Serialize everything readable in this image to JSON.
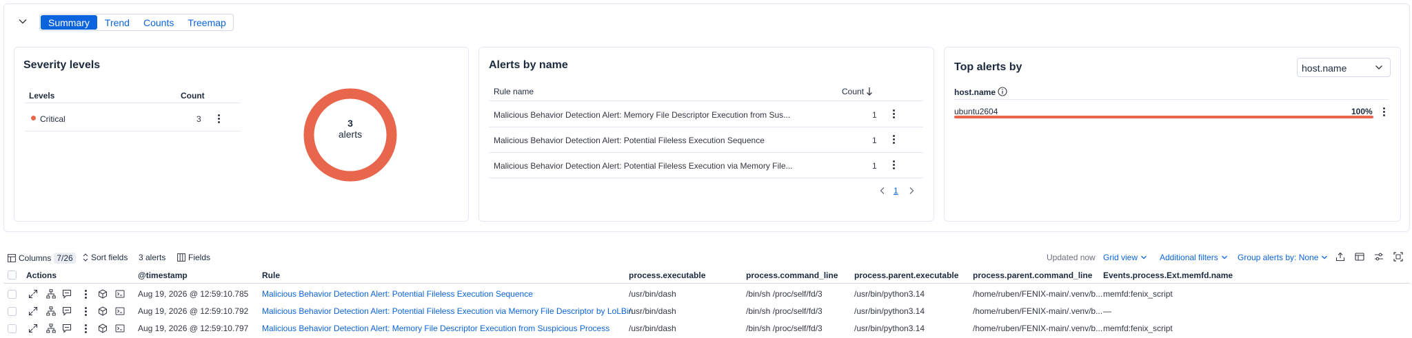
{
  "tabs": [
    {
      "label": "Summary"
    },
    {
      "label": "Trend"
    },
    {
      "label": "Counts"
    },
    {
      "label": "Treemap"
    }
  ],
  "severity": {
    "title": "Severity levels",
    "col_levels": "Levels",
    "col_count": "Count",
    "rows": [
      {
        "level": "Critical",
        "count": "3",
        "color": "#e7664c"
      }
    ],
    "donut_value": "3",
    "donut_label": "alerts",
    "donut_color": "#e7664c"
  },
  "alerts_by_name": {
    "title": "Alerts by name",
    "col_rule": "Rule name",
    "col_count": "Count",
    "rows": [
      {
        "name": "Malicious Behavior Detection Alert: Memory File Descriptor Execution from Sus...",
        "count": "1"
      },
      {
        "name": "Malicious Behavior Detection Alert: Potential Fileless Execution Sequence",
        "count": "1"
      },
      {
        "name": "Malicious Behavior Detection Alert: Potential Fileless Execution via Memory File...",
        "count": "1"
      }
    ],
    "page": "1"
  },
  "top_alerts": {
    "title": "Top alerts by",
    "select_value": "host.name",
    "field_label": "host.name",
    "rows": [
      {
        "name": "ubuntu2604",
        "percent": "100%",
        "fraction": 1.0,
        "color": "#e7664c"
      }
    ]
  },
  "toolbar": {
    "columns_label": "Columns",
    "columns_count": "7/26",
    "sort_label": "Sort fields",
    "alerts_count": "3 alerts",
    "fields_label": "Fields",
    "updated": "Updated now",
    "grid_view": "Grid view",
    "additional_filters": "Additional filters",
    "group_by": "Group alerts by: None"
  },
  "table": {
    "headers": {
      "actions": "Actions",
      "timestamp": "@timestamp",
      "rule": "Rule",
      "executable": "process.executable",
      "command_line": "process.command_line",
      "parent_executable": "process.parent.executable",
      "parent_command_line": "process.parent.command_line",
      "memfd": "Events.process.Ext.memfd.name"
    },
    "rows": [
      {
        "timestamp": "Aug 19, 2026 @ 12:59:10.785",
        "rule": "Malicious Behavior Detection Alert: Potential Fileless Execution Sequence",
        "executable": "/usr/bin/dash",
        "command_line": "/bin/sh /proc/self/fd/3",
        "parent_executable": "/usr/bin/python3.14",
        "parent_command_line": "/home/ruben/FENIX-main/.venv/b...",
        "memfd": "memfd:fenix_script"
      },
      {
        "timestamp": "Aug 19, 2026 @ 12:59:10.792",
        "rule": "Malicious Behavior Detection Alert: Potential Fileless Execution via Memory File Descriptor by LoLBin",
        "executable": "/usr/bin/dash",
        "command_line": "/bin/sh /proc/self/fd/3",
        "parent_executable": "/usr/bin/python3.14",
        "parent_command_line": "/home/ruben/FENIX-main/.venv/b...",
        "memfd": "—"
      },
      {
        "timestamp": "Aug 19, 2026 @ 12:59:10.797",
        "rule": "Malicious Behavior Detection Alert: Memory File Descriptor Execution from Suspicious Process",
        "executable": "/usr/bin/dash",
        "command_line": "/bin/sh /proc/self/fd/3",
        "parent_executable": "/usr/bin/python3.14",
        "parent_command_line": "/home/ruben/FENIX-main/.venv/b...",
        "memfd": "memfd:fenix_script"
      }
    ]
  }
}
